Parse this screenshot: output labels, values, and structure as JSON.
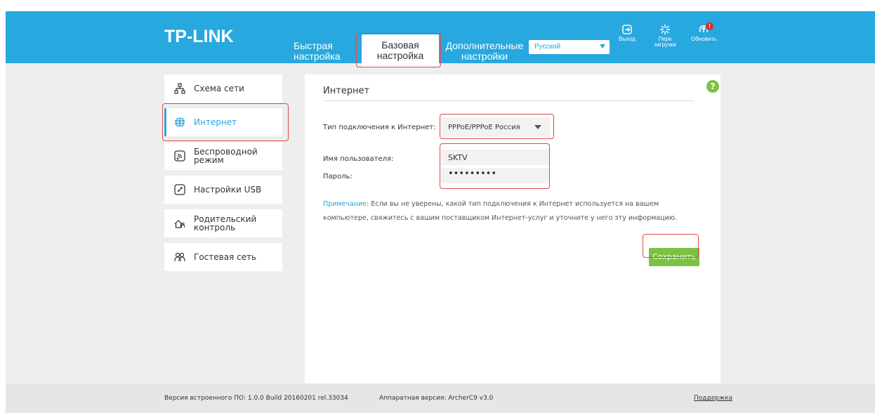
{
  "header": {
    "logo": "TP-LINK",
    "tabs": [
      {
        "line1": "Быстрая",
        "line2": "настройка"
      },
      {
        "line1": "Базовая",
        "line2": "настройка"
      },
      {
        "line1": "Дополнительные",
        "line2": "настройки"
      }
    ],
    "language": "Русский",
    "logout_label": "Выход",
    "reboot_label_1": "Перe",
    "reboot_label_2": "загрузка",
    "update_label": "Обновить",
    "update_badge": "!"
  },
  "sidebar": {
    "items": [
      {
        "label": "Схема сети",
        "icon": "network-map-icon"
      },
      {
        "label": "Интернет",
        "icon": "globe-icon"
      },
      {
        "label": "Беспроводной режим",
        "icon": "wireless-icon"
      },
      {
        "label": "Настройки USB",
        "icon": "usb-icon"
      },
      {
        "label": "Родительский контроль",
        "icon": "parental-control-icon"
      },
      {
        "label": "Гостевая сеть",
        "icon": "guest-network-icon"
      }
    ]
  },
  "main": {
    "title": "Интернет",
    "help": "?",
    "connection_type_label": "Тип подключения к Интернет:",
    "connection_type_value": "PPPoE/PPPoE Россия",
    "username_label": "Имя пользователя:",
    "username_value": "SKTV",
    "password_label": "Пароль:",
    "password_value": "•••••••••",
    "note_label": "Примечание:",
    "note_text": " Если вы не уверены, какой тип подключения к Интернет используется на вашем компьютере, свяжитесь с вашим поставщиком Интернет-услуг и уточните у него эту информацию.",
    "save_label": "Сохранить"
  },
  "footer": {
    "firmware": "Версия встроенного ПО: 1.0.0 Build 20160201 rel.33034",
    "hardware": "Аппаратная версия: ArcherC9 v3.0",
    "support": "Поддержка"
  },
  "colors": {
    "header_blue": "#27a8df",
    "accent_green": "#7cc142",
    "highlight_red": "#e04a4a"
  }
}
